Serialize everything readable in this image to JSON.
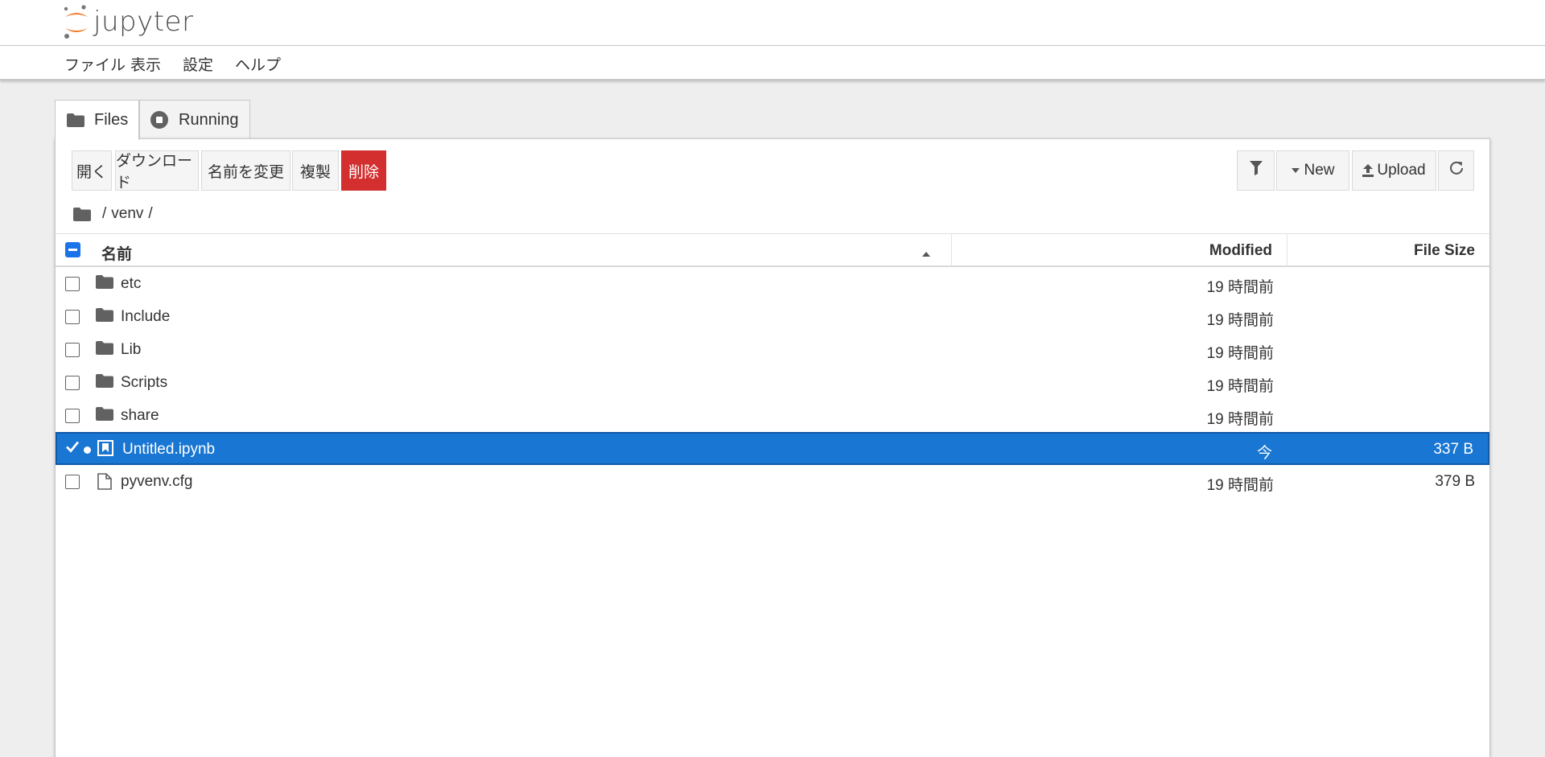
{
  "app": {
    "name": "jupyter"
  },
  "menu": {
    "items": [
      "ファイル",
      "表示",
      "設定",
      "ヘルプ"
    ]
  },
  "tabs": [
    {
      "label": "Files",
      "icon": "folder-icon",
      "active": true
    },
    {
      "label": "Running",
      "icon": "stop-circle-icon",
      "active": false
    }
  ],
  "toolbar": {
    "open": "開く",
    "download": "ダウンロード",
    "rename": "名前を変更",
    "duplicate": "複製",
    "delete": "削除",
    "new": "New",
    "upload": "Upload"
  },
  "breadcrumb": {
    "sep1": "/",
    "folder": "venv",
    "sep2": "/"
  },
  "columns": {
    "name": "名前",
    "modified": "Modified",
    "size": "File Size"
  },
  "files": [
    {
      "name": "etc",
      "type": "folder",
      "modified": "19 時間前",
      "size": ""
    },
    {
      "name": "Include",
      "type": "folder",
      "modified": "19 時間前",
      "size": ""
    },
    {
      "name": "Lib",
      "type": "folder",
      "modified": "19 時間前",
      "size": ""
    },
    {
      "name": "Scripts",
      "type": "folder",
      "modified": "19 時間前",
      "size": ""
    },
    {
      "name": "share",
      "type": "folder",
      "modified": "19 時間前",
      "size": ""
    },
    {
      "name": "Untitled.ipynb",
      "type": "notebook",
      "modified": "今",
      "size": "337 B",
      "selected": true,
      "running": true
    },
    {
      "name": "pyvenv.cfg",
      "type": "file",
      "modified": "19 時間前",
      "size": "379 B"
    }
  ],
  "colors": {
    "accent": "#1976d2",
    "danger": "#d32f2f",
    "logo_orange": "#f37726",
    "icon_gray": "#616161"
  }
}
